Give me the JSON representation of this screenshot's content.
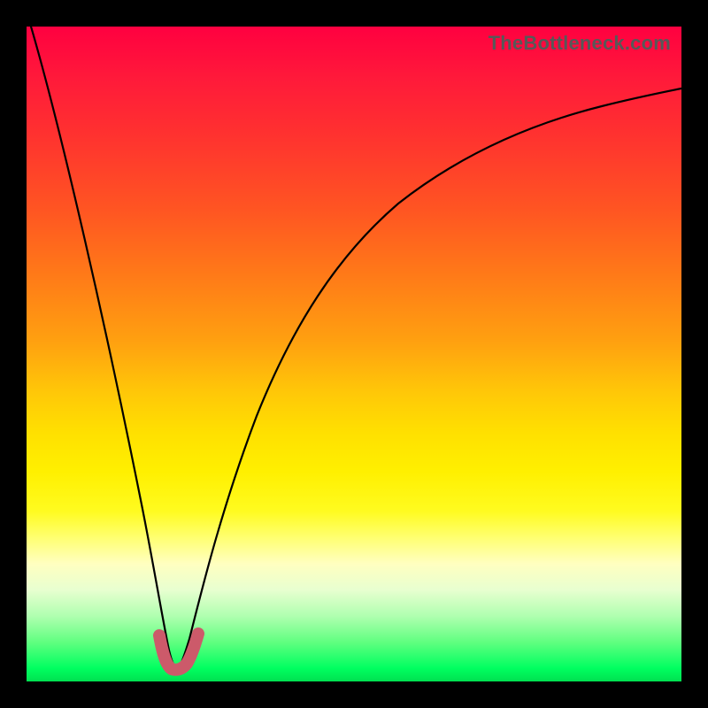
{
  "watermark": "TheBottleneck.com",
  "colors": {
    "top": "#ff0040",
    "mid": "#ffe000",
    "bottom": "#00e050",
    "curve": "#000000",
    "trough": "#cc5a6a",
    "border": "#000000"
  },
  "chart_data": {
    "type": "line",
    "title": "",
    "xlabel": "",
    "ylabel": "",
    "xlim": [
      0,
      100
    ],
    "ylim": [
      0,
      100
    ],
    "grid": false,
    "legend": false,
    "notes": "Axes unlabeled in source image; values are relative estimates read off the plot geometry. Single curve resembling |f(x)| with a sharp minimum near x≈22. A thick pink segment highlights the trough.",
    "series": [
      {
        "name": "bottleneck-curve",
        "x": [
          0,
          2,
          4,
          6,
          8,
          10,
          12,
          14,
          16,
          18,
          19,
          20,
          21,
          22,
          23,
          24,
          25,
          26,
          28,
          30,
          34,
          38,
          42,
          46,
          50,
          55,
          60,
          65,
          70,
          75,
          80,
          85,
          90,
          95,
          100
        ],
        "values": [
          100,
          92,
          84,
          76,
          68,
          60,
          51,
          42,
          32,
          21,
          15,
          9,
          4,
          1,
          1,
          3,
          6,
          10,
          17,
          23,
          34,
          43,
          50,
          56,
          61,
          66,
          70,
          73,
          76,
          78,
          80,
          81.5,
          83,
          83.8,
          84.5
        ]
      },
      {
        "name": "trough-highlight",
        "x": [
          19.5,
          20.5,
          21.5,
          22.5,
          23.5,
          24.5
        ],
        "values": [
          5,
          2,
          0.5,
          0.5,
          2,
          5
        ]
      }
    ]
  }
}
